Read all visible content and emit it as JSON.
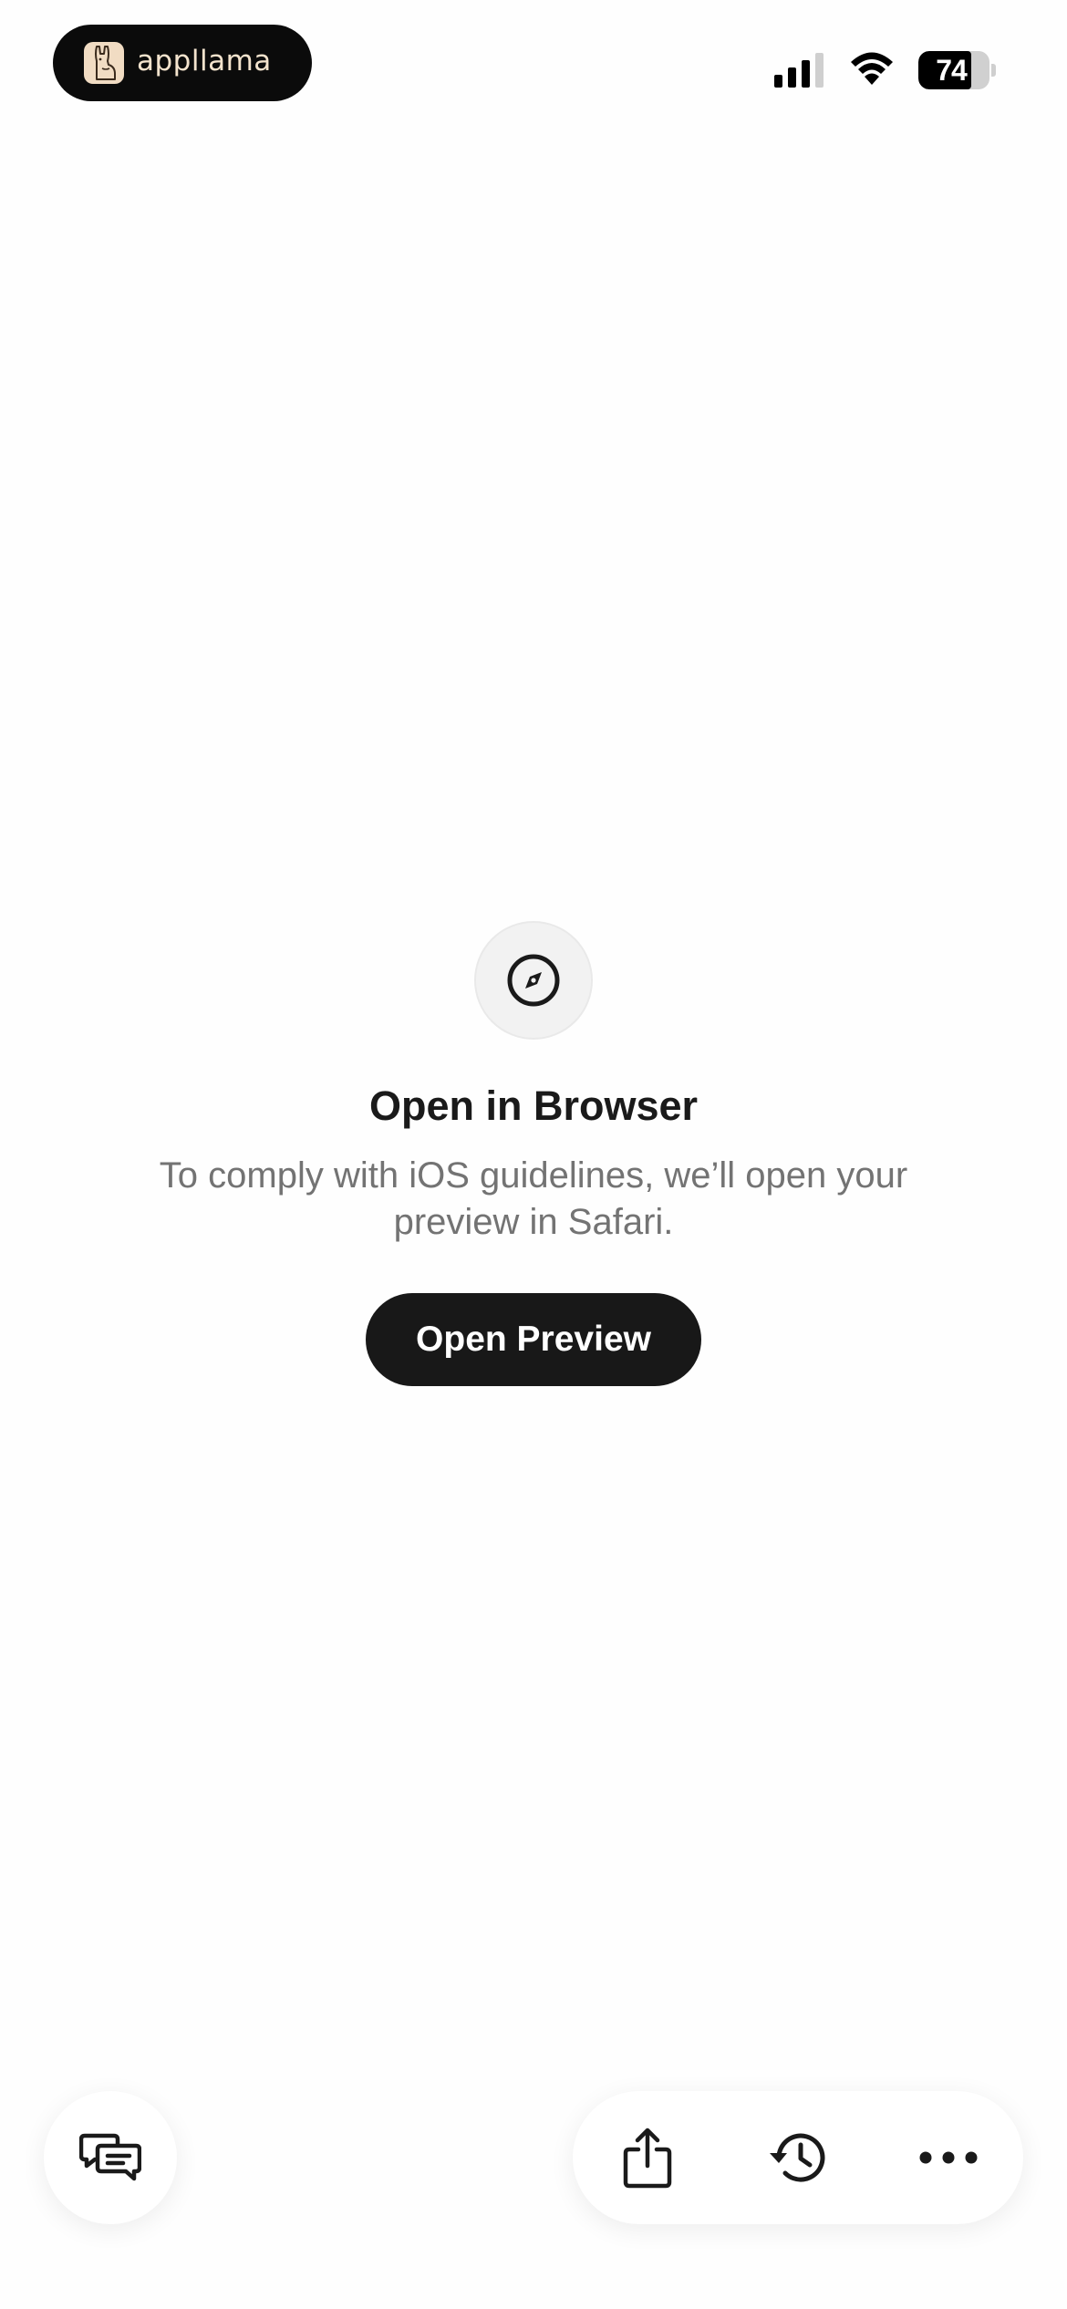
{
  "status_bar": {
    "app_name": "appllama",
    "battery_percent": 74,
    "battery_label": "74",
    "signal_bars_active": 3,
    "signal_bars_total": 4
  },
  "content": {
    "icon": "compass-icon",
    "title": "Open in Browser",
    "message": "To comply with iOS guidelines, we’ll open your preview in Safari.",
    "button_label": "Open Preview"
  },
  "bottom_bar": {
    "left_icon": "chat-bubbles-icon",
    "toolbar_icons": [
      "share-icon",
      "history-icon",
      "more-icon"
    ]
  },
  "colors": {
    "background": "#fefefe",
    "primary_button": "#181818",
    "title_text": "#1a1a1a",
    "message_text": "#737373",
    "app_pill": "#0b0b0b",
    "app_pill_text": "#f3e3cd"
  }
}
